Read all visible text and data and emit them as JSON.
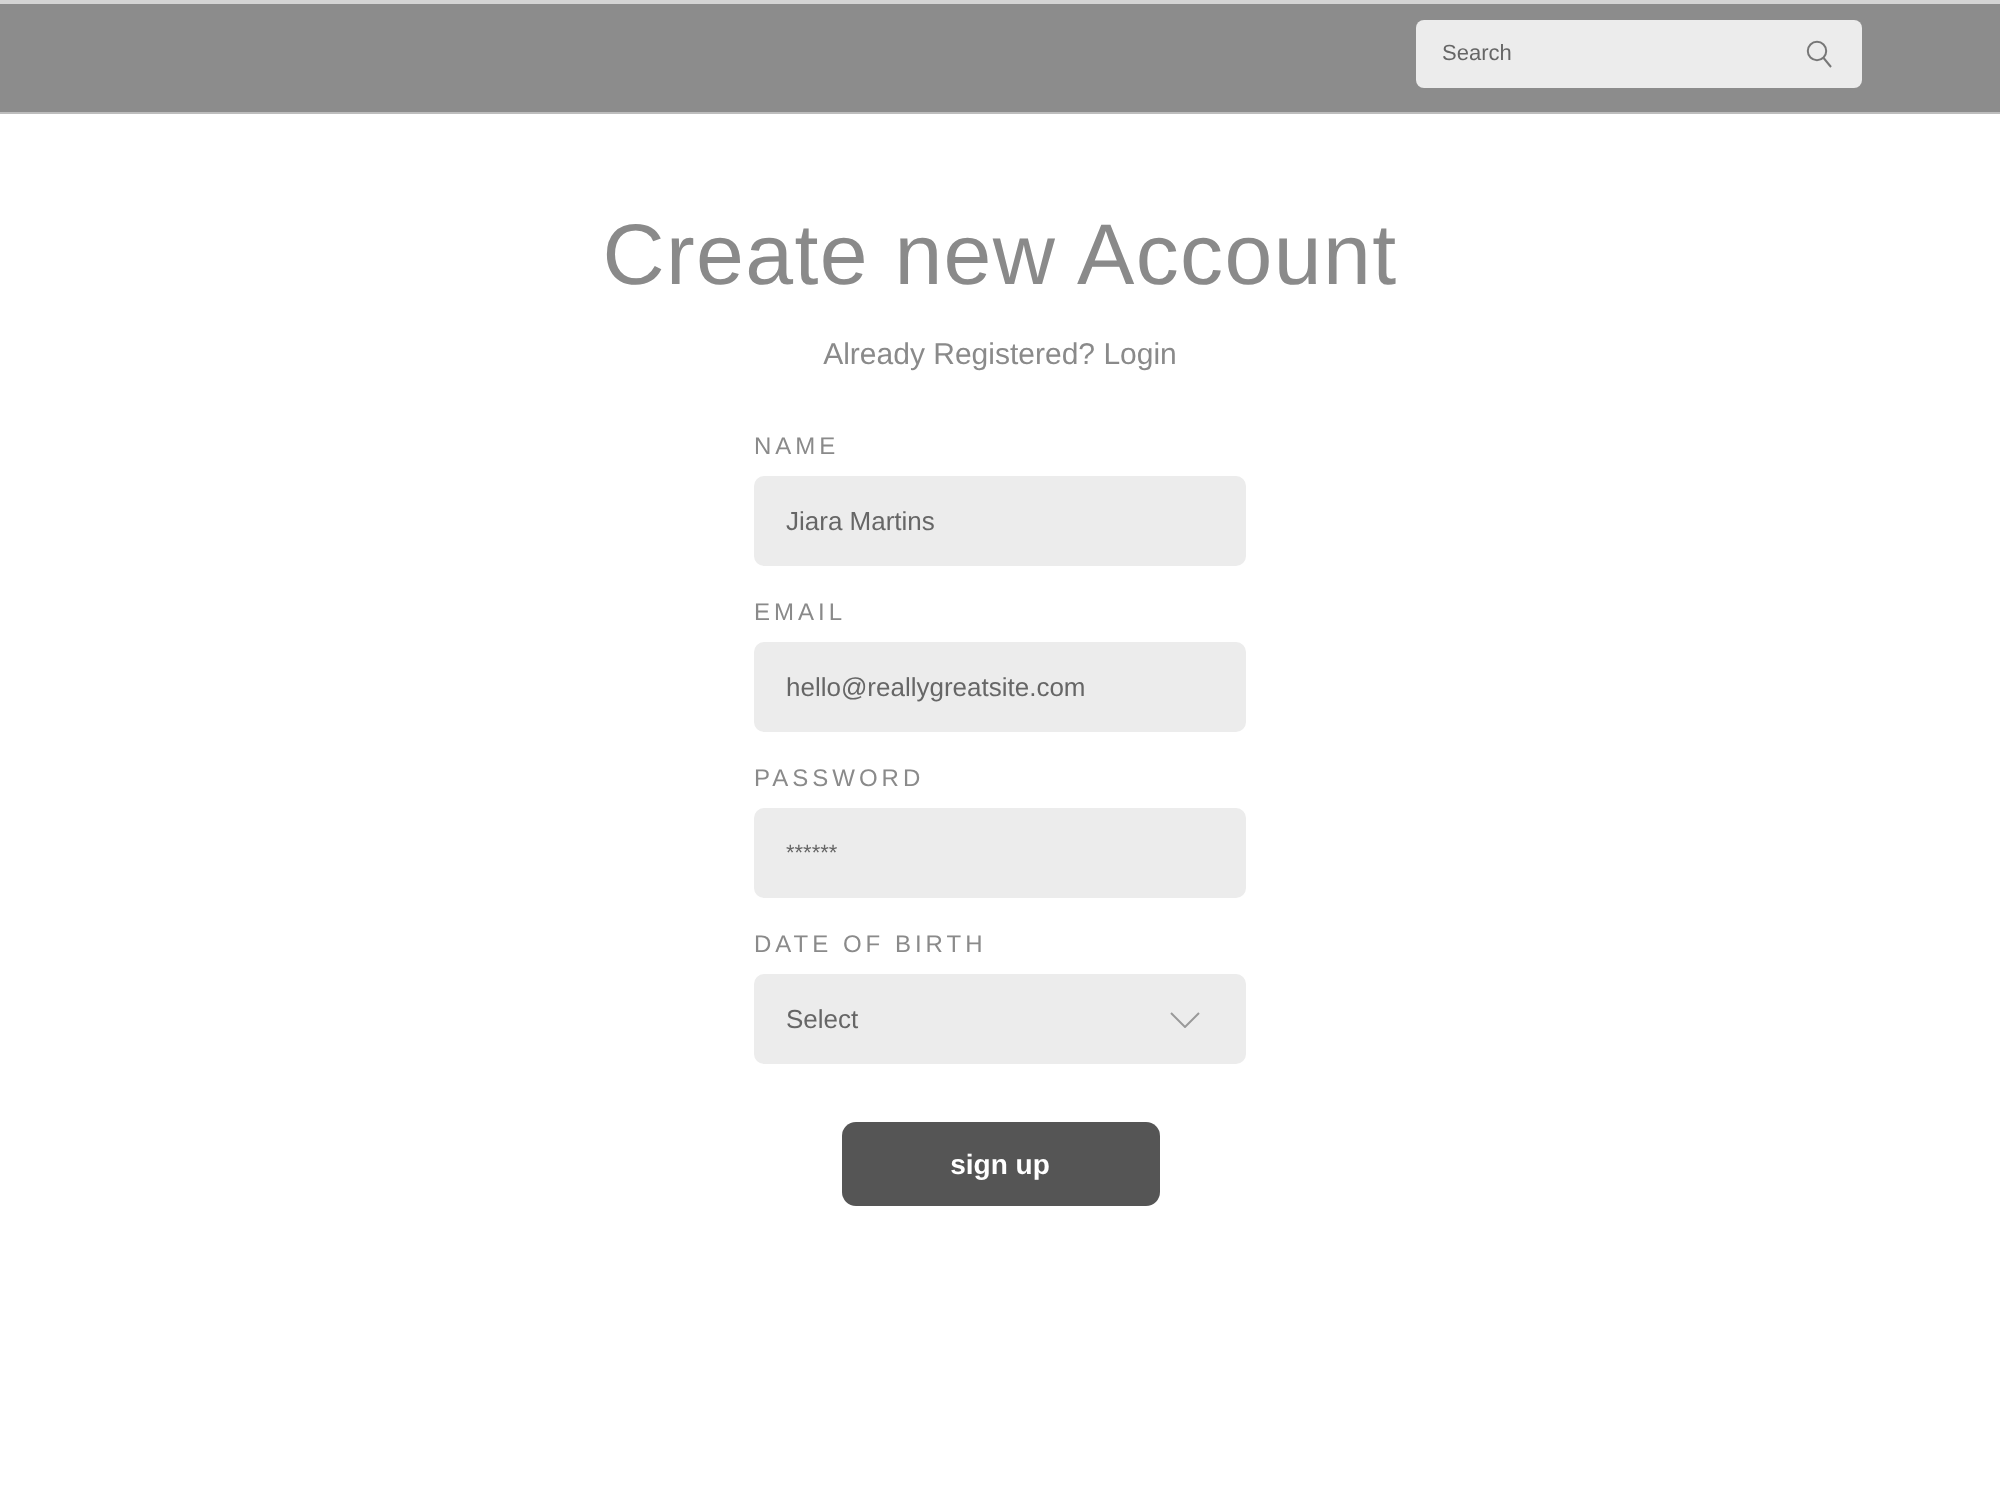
{
  "header": {
    "search": {
      "placeholder": "Search"
    }
  },
  "title": "Create new Account",
  "subtitle": {
    "text": "Already Registered?",
    "link": "Login"
  },
  "fields": [
    {
      "kind": "text",
      "label": "NAME",
      "value": "Jiara Martins"
    },
    {
      "kind": "text",
      "label": "EMAIL",
      "value": "hello@reallygreatsite.com"
    },
    {
      "kind": "password",
      "label": "PASSWORD",
      "value": "******"
    },
    {
      "kind": "select",
      "label": "DATE OF BIRTH",
      "placeholder": "Select"
    }
  ],
  "buttons": [
    "sign up"
  ]
}
